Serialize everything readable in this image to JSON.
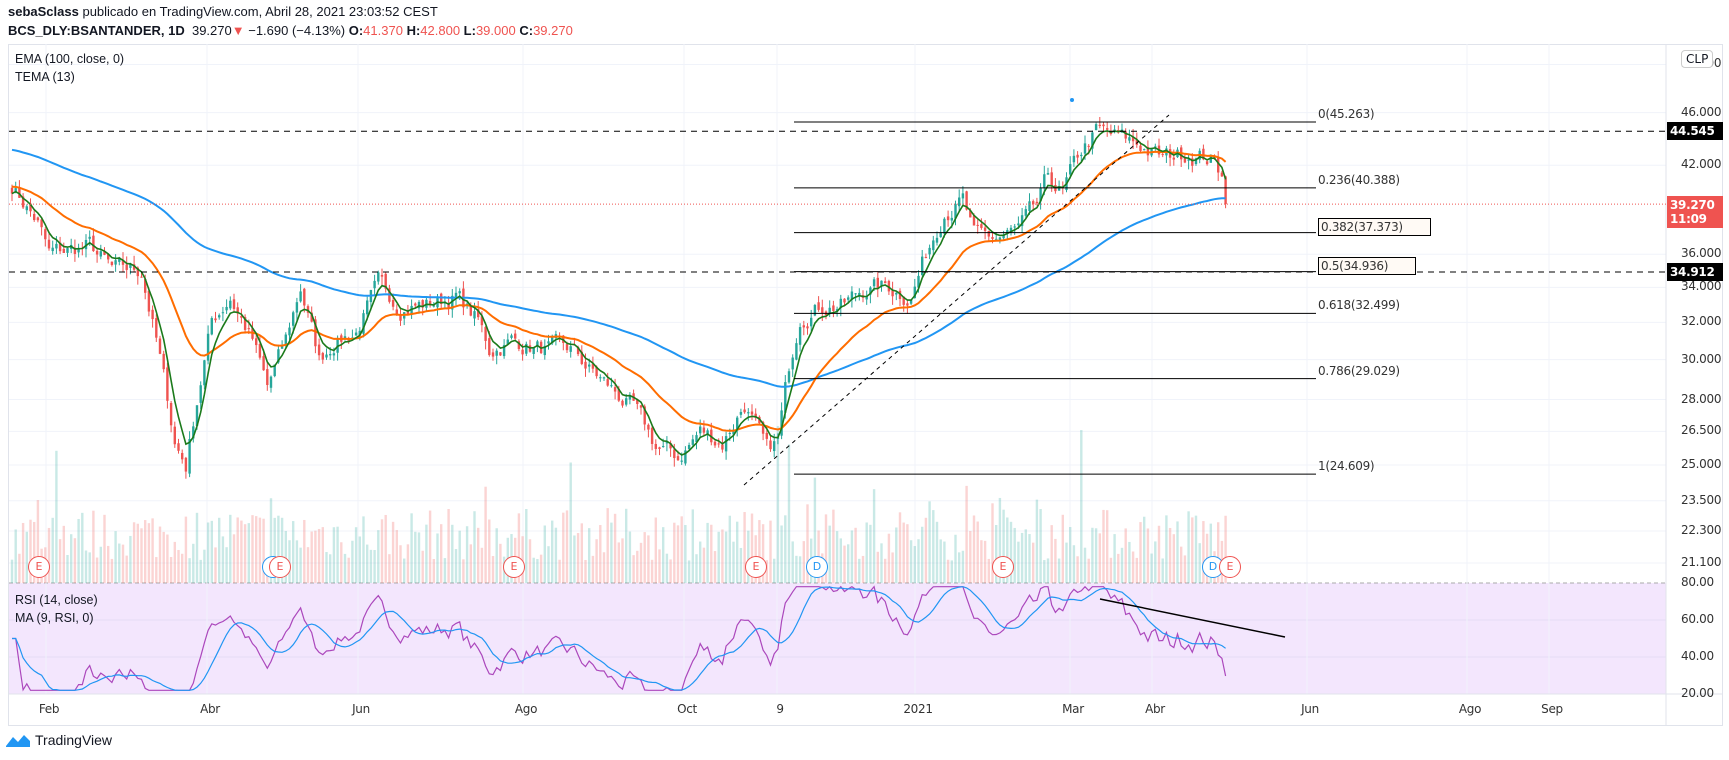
{
  "header": {
    "author": "sebaSclass",
    "published": "publicado en TradingView.com, Abril 28, 2021 23:03:52 CEST",
    "symbol": "BCS_DLY:BSANTANDER, 1D",
    "last": "39.270",
    "change": "−1.690 (−4.13%)",
    "o_label": "O:",
    "o": "41.370",
    "h_label": "H:",
    "h": "42.800",
    "l_label": "L:",
    "l": "39.000",
    "c_label": "C:",
    "c": "39.270"
  },
  "legend": {
    "ema": "EMA (100, close, 0)",
    "tema": "TEMA (13)",
    "rsi": "RSI (14, close)",
    "ma": "MA (9, RSI, 0)"
  },
  "currency": "CLP",
  "price_axis": [
    "50.000",
    "46.000",
    "42.000",
    "36.000",
    "34.000",
    "32.000",
    "30.000",
    "28.000",
    "26.500",
    "25.000",
    "23.500",
    "22.300",
    "21.100"
  ],
  "rsi_axis": [
    "80.00",
    "60.00",
    "40.00",
    "20.00"
  ],
  "time_axis": [
    "Feb",
    "Abr",
    "Jun",
    "Ago",
    "Oct",
    "9",
    "2021",
    "Mar",
    "Abr",
    "Jun",
    "Ago",
    "Sep"
  ],
  "tags": {
    "resistance": "44.545",
    "support": "34.912",
    "price": "39.270",
    "countdown": "11:09"
  },
  "fib": [
    {
      "label": "0(45.263)",
      "price": 45.263
    },
    {
      "label": "0.236(40.388)",
      "price": 40.388
    },
    {
      "label": "0.382(37.373)",
      "price": 37.373,
      "boxed": true
    },
    {
      "label": "0.5(34.936)",
      "price": 34.936,
      "boxed": true
    },
    {
      "label": "0.618(32.499)",
      "price": 32.499
    },
    {
      "label": "0.786(29.029)",
      "price": 29.029
    },
    {
      "label": "1(24.609)",
      "price": 24.609
    }
  ],
  "markers": [
    {
      "t": "E",
      "kind": "earnings"
    },
    {
      "t": "D",
      "kind": "dividend"
    },
    {
      "t": "E",
      "kind": "earnings"
    },
    {
      "t": "E",
      "kind": "earnings"
    },
    {
      "t": "E",
      "kind": "earnings"
    },
    {
      "t": "D",
      "kind": "dividend"
    },
    {
      "t": "E",
      "kind": "earnings"
    },
    {
      "t": "D",
      "kind": "dividend"
    },
    {
      "t": "E",
      "kind": "earnings"
    }
  ],
  "logo": "TradingView",
  "colors": {
    "up": "#26a69a",
    "down": "#ef5350",
    "ema100": "#2196f3",
    "ema_mid": "#ff6d00",
    "tema": "#1b7a1b",
    "rsi": "#ab47bc",
    "rsi_ma": "#2196f3",
    "rsi_bg": "#f3e6fd"
  },
  "chart_data": {
    "type": "candlestick",
    "title": "BCS_DLY:BSANTANDER, 1D",
    "scale": "log",
    "ylim": [
      20.5,
      51
    ],
    "x_unit": "trading day index",
    "close_path": [
      [
        0,
        40.6
      ],
      [
        7,
        38
      ],
      [
        10,
        36
      ],
      [
        21,
        36.5
      ],
      [
        27,
        35
      ],
      [
        35,
        35
      ],
      [
        39,
        31
      ],
      [
        44,
        26
      ],
      [
        47,
        25
      ],
      [
        50,
        28
      ],
      [
        54,
        32
      ],
      [
        59,
        33.5
      ],
      [
        65,
        31
      ],
      [
        69,
        28.5
      ],
      [
        74,
        31
      ],
      [
        78,
        34
      ],
      [
        83,
        30
      ],
      [
        87,
        31
      ],
      [
        93,
        31.5
      ],
      [
        99,
        34
      ],
      [
        105,
        33
      ],
      [
        112,
        33
      ],
      [
        120,
        33.5
      ],
      [
        126,
        32
      ],
      [
        129,
        30.5
      ],
      [
        135,
        31
      ],
      [
        144,
        30.5
      ],
      [
        151,
        30.5
      ],
      [
        156,
        29.5
      ],
      [
        162,
        28.5
      ],
      [
        168,
        27.5
      ],
      [
        174,
        25.8
      ],
      [
        180,
        25.3
      ],
      [
        186,
        26.5
      ],
      [
        192,
        26
      ],
      [
        198,
        27.8
      ],
      [
        204,
        25.5
      ],
      [
        207,
        26
      ],
      [
        210,
        29.5
      ],
      [
        213,
        32.5
      ],
      [
        219,
        33
      ],
      [
        225,
        33
      ],
      [
        231,
        34
      ],
      [
        237,
        34
      ],
      [
        243,
        33.5
      ],
      [
        247,
        36
      ],
      [
        252,
        39
      ],
      [
        257,
        39.5
      ],
      [
        260,
        37
      ],
      [
        266,
        37
      ],
      [
        272,
        37.5
      ],
      [
        277,
        39
      ],
      [
        280,
        41
      ],
      [
        284,
        40
      ],
      [
        289,
        43
      ],
      [
        293,
        44.5
      ],
      [
        299,
        44
      ],
      [
        305,
        43.5
      ],
      [
        311,
        42.5
      ],
      [
        318,
        43
      ],
      [
        324,
        42.5
      ],
      [
        327,
        41.2
      ],
      [
        328,
        39.27
      ]
    ]
  }
}
